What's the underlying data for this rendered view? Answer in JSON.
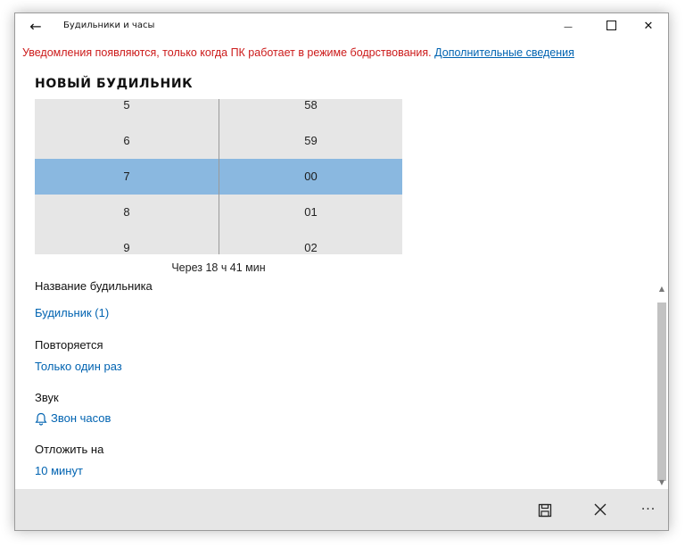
{
  "window": {
    "title": "Будильники и часы",
    "back_glyph": "←",
    "minimize_glyph": "—",
    "close_glyph": "✕"
  },
  "notice": {
    "text": "Уведомления появляются, только когда ПК работает в режиме бодрствования.",
    "link": "Дополнительные сведения"
  },
  "heading": "НОВЫЙ БУДИЛЬНИК",
  "picker": {
    "hours": [
      "5",
      "6",
      "7",
      "8",
      "9"
    ],
    "minutes": [
      "58",
      "59",
      "00",
      "01",
      "02"
    ],
    "selected_hour": "7",
    "selected_minute": "00"
  },
  "countdown": "Через 18 ч 41 мин",
  "fields": {
    "name_label": "Название будильника",
    "name_value": "Будильник (1)",
    "repeat_label": "Повторяется",
    "repeat_value": "Только один раз",
    "sound_label": "Звук",
    "sound_value": "Звон часов",
    "snooze_label": "Отложить на",
    "snooze_value": "10 минут"
  },
  "commandbar": {
    "more_glyph": "···"
  },
  "colors": {
    "accent": "#0063b1",
    "warning": "#cc1a1a",
    "selected_band": "#8ab8e0",
    "picker_bg": "#e6e6e6"
  },
  "icons": {
    "back": "back-arrow-icon",
    "save": "save-icon",
    "cancel": "close-icon",
    "sound": "bell-icon"
  }
}
